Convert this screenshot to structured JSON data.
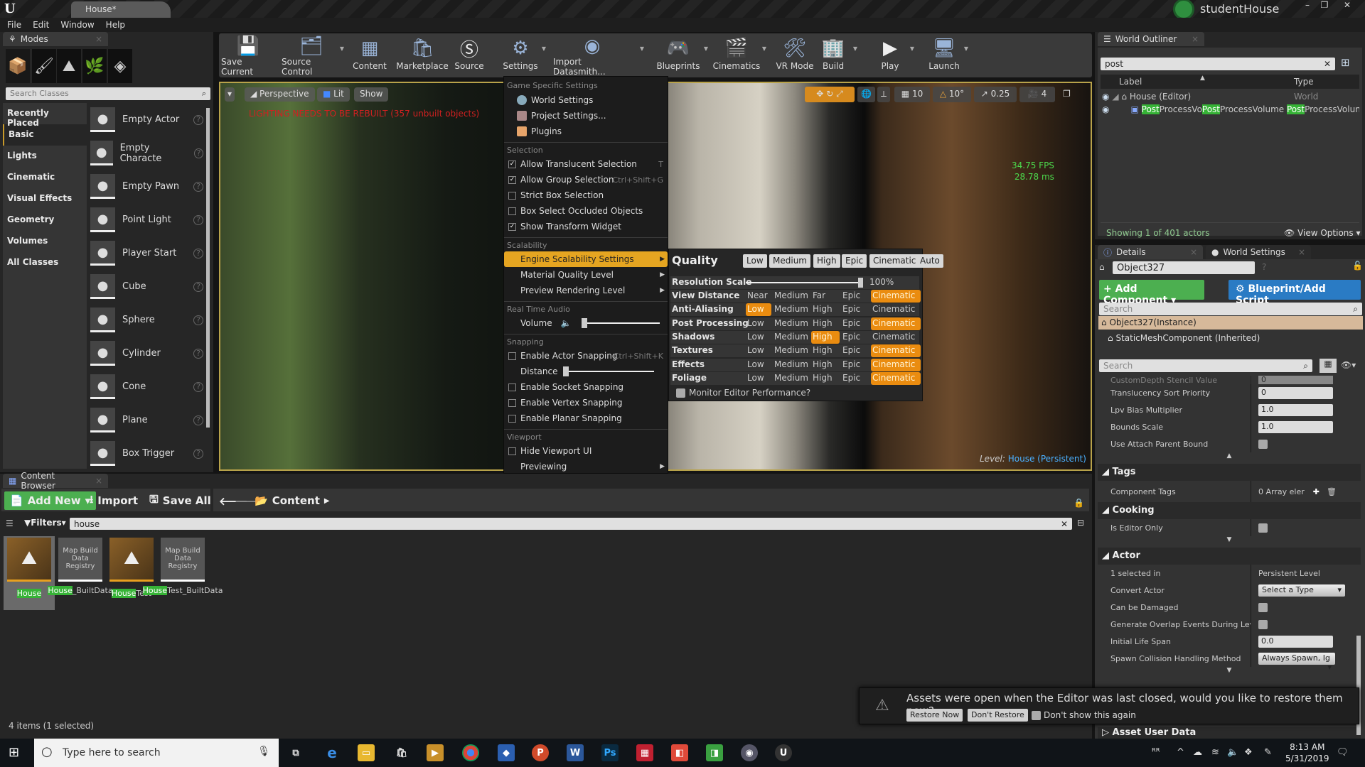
{
  "window": {
    "title": "House*",
    "user": "studentHouse"
  },
  "menubar": [
    "File",
    "Edit",
    "Window",
    "Help"
  ],
  "modes": {
    "tab": "Modes",
    "search_placeholder": "Search Classes",
    "categories": [
      "Recently Placed",
      "Basic",
      "Lights",
      "Cinematic",
      "Visual Effects",
      "Geometry",
      "Volumes",
      "All Classes"
    ],
    "selected_category": "Basic",
    "classes": [
      "Empty Actor",
      "Empty Characte",
      "Empty Pawn",
      "Point Light",
      "Player Start",
      "Cube",
      "Sphere",
      "Cylinder",
      "Cone",
      "Plane",
      "Box Trigger"
    ]
  },
  "toolbar": [
    "Save Current",
    "Source Control",
    "Content",
    "Marketplace",
    "Source",
    "Settings",
    "Import Datasmith...",
    "Blueprints",
    "Cinematics",
    "VR Mode",
    "Build",
    "Play",
    "Launch"
  ],
  "viewport": {
    "perspective": "Perspective",
    "lit": "Lit",
    "show": "Show",
    "warning": "LIGHTING NEEDS TO BE REBUILT (357 unbuilt objects)",
    "fps": "34.75 FPS",
    "ms": "28.78 ms",
    "level_label": "Level:",
    "level": "House (Persistent)",
    "grid": "10",
    "angle": "10°",
    "scale": "0.25",
    "camera_speed": "4"
  },
  "settings_menu": {
    "h_game": "Game Specific Settings",
    "world_settings": "World Settings",
    "project_settings": "Project Settings...",
    "plugins": "Plugins",
    "h_selection": "Selection",
    "selection": [
      {
        "label": "Allow Translucent Selection",
        "checked": true,
        "shortcut": "T"
      },
      {
        "label": "Allow Group Selection",
        "checked": true,
        "shortcut": "Ctrl+Shift+G"
      },
      {
        "label": "Strict Box Selection",
        "checked": false,
        "shortcut": ""
      },
      {
        "label": "Box Select Occluded Objects",
        "checked": false,
        "shortcut": ""
      },
      {
        "label": "Show Transform Widget",
        "checked": true,
        "shortcut": ""
      }
    ],
    "h_scalability": "Scalability",
    "engine_scalability": "Engine Scalability Settings",
    "material_quality": "Material Quality Level",
    "preview_rendering": "Preview Rendering Level",
    "h_audio": "Real Time Audio",
    "volume": "Volume",
    "volume_level": 0.0,
    "h_snapping": "Snapping",
    "actor_snapping": "Enable Actor Snapping",
    "actor_snapping_shortcut": "Ctrl+Shift+K",
    "distance": "Distance",
    "distance_level": 0.0,
    "socket_snapping": "Enable Socket Snapping",
    "vertex_snapping": "Enable Vertex Snapping",
    "planar_snapping": "Enable Planar Snapping",
    "h_viewport": "Viewport",
    "hide_viewport_ui": "Hide Viewport UI",
    "previewing": "Previewing"
  },
  "quality": {
    "title": "Quality",
    "presets": [
      "Low",
      "Medium",
      "High",
      "Epic",
      "Cinematic",
      "Auto"
    ],
    "resolution_label": "Resolution Scale",
    "resolution": "100%",
    "rows": [
      {
        "label": "View Distance",
        "options": [
          "Near",
          "Medium",
          "Far",
          "Epic",
          "Cinematic"
        ],
        "selected": 4
      },
      {
        "label": "Anti-Aliasing",
        "options": [
          "Low",
          "Medium",
          "High",
          "Epic",
          "Cinematic"
        ],
        "selected": 0
      },
      {
        "label": "Post Processing",
        "options": [
          "Low",
          "Medium",
          "High",
          "Epic",
          "Cinematic"
        ],
        "selected": 4
      },
      {
        "label": "Shadows",
        "options": [
          "Low",
          "Medium",
          "High",
          "Epic",
          "Cinematic"
        ],
        "selected": 2
      },
      {
        "label": "Textures",
        "options": [
          "Low",
          "Medium",
          "High",
          "Epic",
          "Cinematic"
        ],
        "selected": 4
      },
      {
        "label": "Effects",
        "options": [
          "Low",
          "Medium",
          "High",
          "Epic",
          "Cinematic"
        ],
        "selected": 4
      },
      {
        "label": "Foliage",
        "options": [
          "Low",
          "Medium",
          "High",
          "Epic",
          "Cinematic"
        ],
        "selected": 4
      }
    ],
    "monitor": "Monitor Editor Performance?"
  },
  "outliner": {
    "tab": "World Outliner",
    "search": "post",
    "col_label": "Label",
    "col_type": "Type",
    "rows": [
      {
        "label": "House (Editor)",
        "type": "World"
      },
      {
        "label_a": "Post",
        "label_b": "ProcessVo",
        "label_c": "Post",
        "label_d": "ProcessVolume",
        "type_a": "Post",
        "type_b": "ProcessVolun"
      }
    ],
    "status": "Showing 1 of 401 actors",
    "view_options": "View Options"
  },
  "details": {
    "tab": "Details",
    "tab2": "World Settings",
    "object": "Object327",
    "add_component": "+ Add Component",
    "blueprint": "Blueprint/Add Script",
    "search_placeholder": "Search",
    "instance": "Object327(Instance)",
    "component": "StaticMeshComponent (Inherited)",
    "search2_placeholder": "Search",
    "props": [
      {
        "label": "CustomDepth Stencil Value",
        "value": "0"
      },
      {
        "label": "Translucency Sort Priority",
        "value": "0"
      },
      {
        "label": "Lpv Bias Multiplier",
        "value": "1.0"
      },
      {
        "label": "Bounds Scale",
        "value": "1.0"
      }
    ],
    "use_attach": "Use Attach Parent Bound",
    "tags": "Tags",
    "component_tags": "Component Tags",
    "array": "0 Array eler",
    "cooking": "Cooking",
    "editor_only": "Is Editor Only",
    "actor": "Actor",
    "selected_in": "1 selected in",
    "persistent": "Persistent Level",
    "convert": "Convert Actor",
    "select_type": "Select a Type",
    "damaged": "Can be Damaged",
    "overlap": "Generate Overlap Events During Level Stre",
    "life_label": "Initial Life Span",
    "life": "0.0",
    "spawn_label": "Spawn Collision Handling Method",
    "spawn": "Always Spawn, Ig",
    "asset_user_data": "Asset User Data"
  },
  "content_browser": {
    "tab": "Content Browser",
    "add_new": "Add New",
    "import": "Import",
    "save_all": "Save All",
    "path": "Content",
    "filters": "Filters",
    "search": "house",
    "status": "4 items (1 selected)",
    "assets": [
      {
        "hl": "House",
        "rest": "",
        "thumb": ""
      },
      {
        "hl": "House",
        "rest": "_BuiltData",
        "thumb": "Map Build Data Registry"
      },
      {
        "hl": "House",
        "rest": "Test",
        "thumb": ""
      },
      {
        "hl": "House",
        "rest": "Test_BuiltData",
        "thumb": "Map Build Data Registry"
      }
    ]
  },
  "notification": {
    "message": "Assets were open when the Editor was last closed, would you like to restore them now?",
    "restore": "Restore Now",
    "dont": "Don't Restore",
    "dont_show": "Don't show this again"
  },
  "taskbar": {
    "search": "Type here to search",
    "time": "8:13 AM",
    "date": "5/31/2019"
  },
  "colors": {
    "highlight": "#e5a521",
    "quality_on": "#ea8c10",
    "green": "#4caf50",
    "blue": "#2a7bc4"
  }
}
